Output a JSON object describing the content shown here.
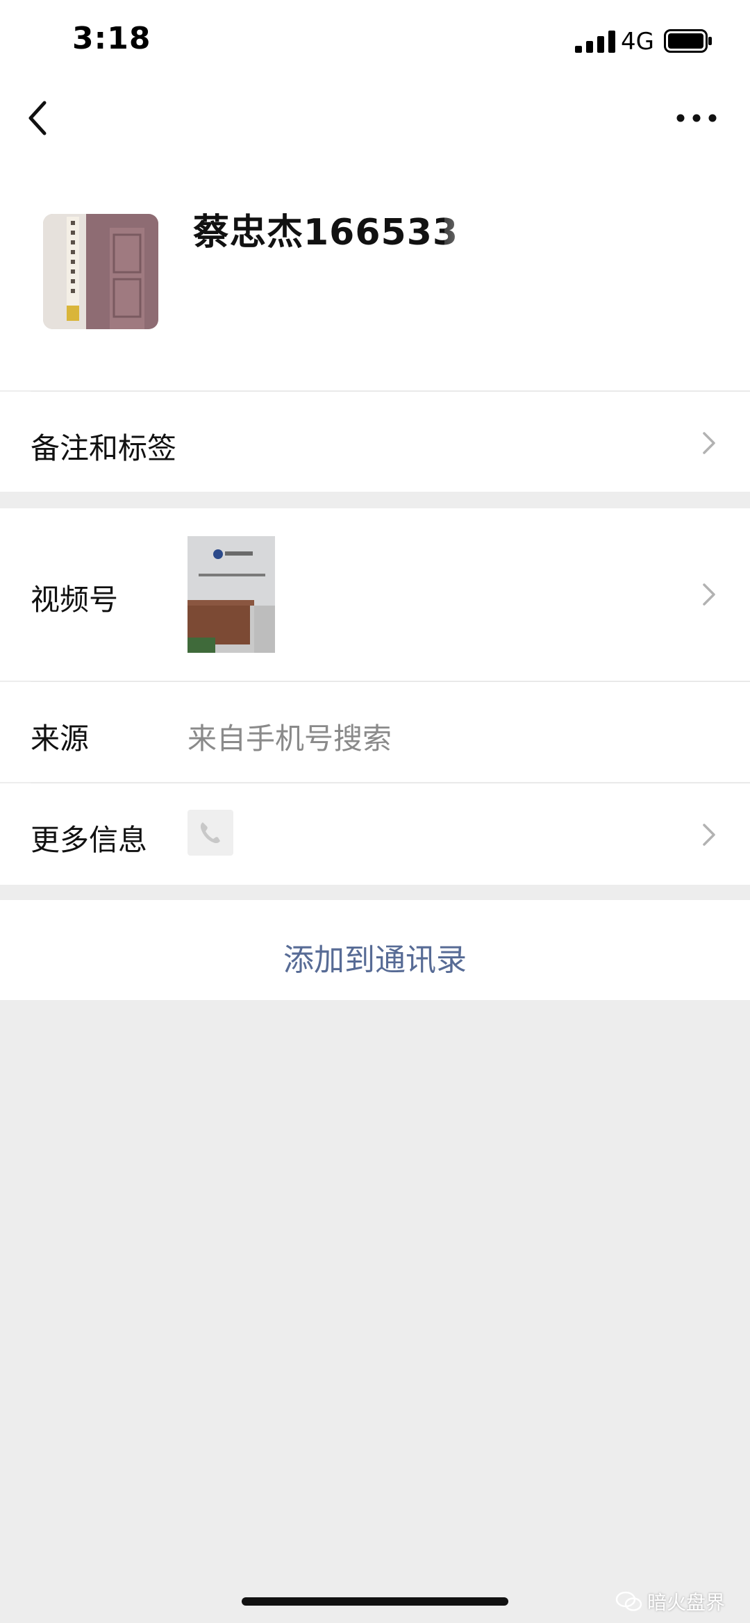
{
  "status_bar": {
    "time": "3:18",
    "network": "4G",
    "icons": [
      "signal-icon",
      "battery-icon"
    ]
  },
  "nav": {
    "icons": [
      "back-arrow-icon",
      "more-dots-icon"
    ]
  },
  "profile": {
    "name": "蔡忠杰166533"
  },
  "rows": {
    "remark_label": "备注和标签",
    "channels_label": "视频号",
    "source_label": "来源",
    "source_value": "来自手机号搜索",
    "more_info_label": "更多信息"
  },
  "actions": {
    "add_contact": "添加到通讯录"
  },
  "watermark": {
    "text": "暗火盘界"
  },
  "colors": {
    "link_blue": "#576b95",
    "background_gray": "#ededed",
    "secondary_text": "#8a8a8a"
  }
}
